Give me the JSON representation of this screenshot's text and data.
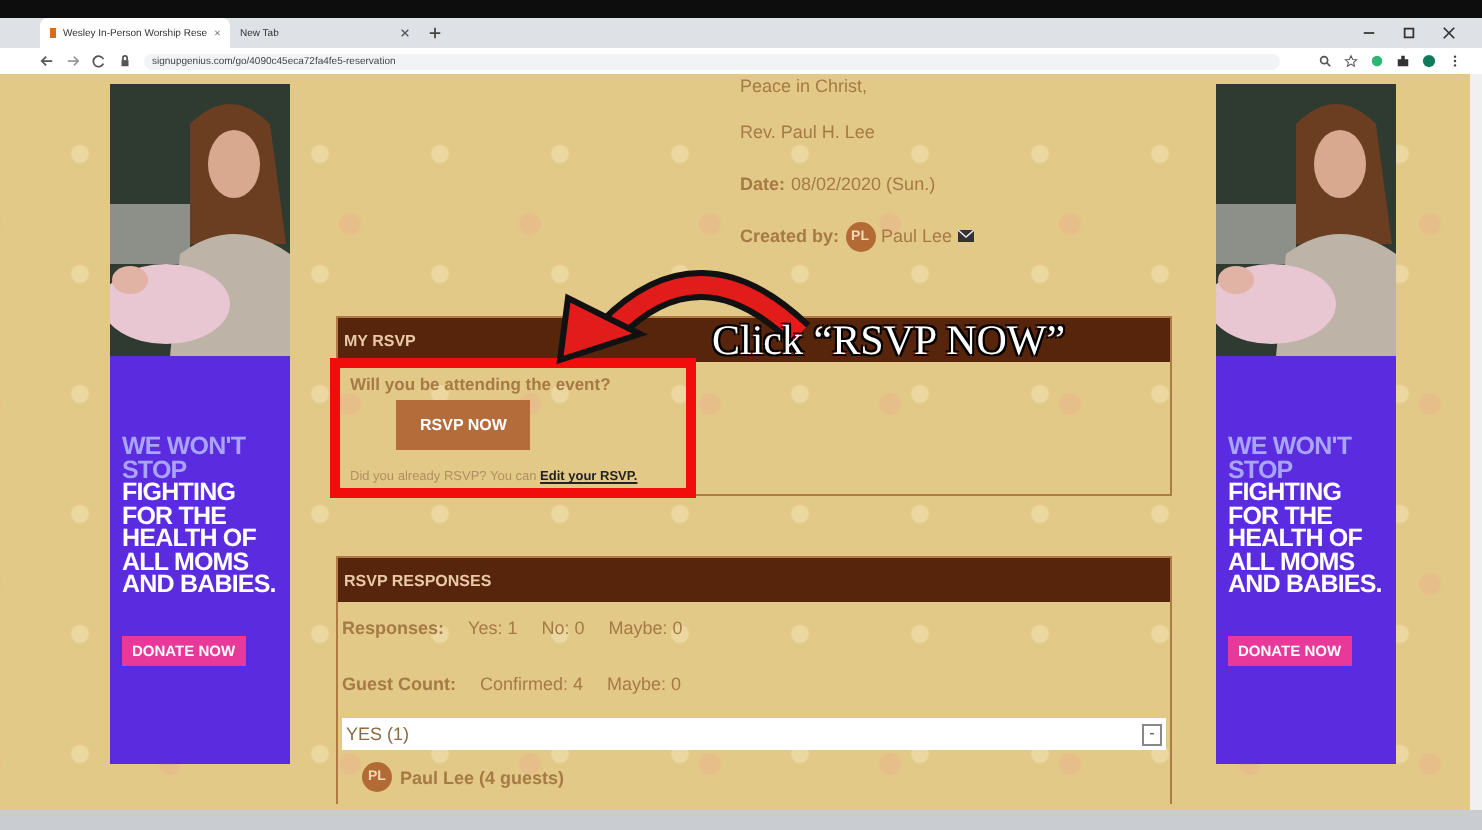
{
  "browser": {
    "tabs": [
      {
        "title": "Wesley In-Person Worship Rese",
        "selected": true
      },
      {
        "title": "New Tab",
        "selected": false
      }
    ],
    "url": "signupgenius.com/go/4090c45eca72fa4fe5-reservation"
  },
  "ads": [
    {
      "headline_accent": "WE WON'T STOP",
      "headline": "FIGHTING FOR THE HEALTH OF ALL MOMS AND BABIES.",
      "button": "DONATE NOW"
    },
    {
      "headline_accent": "WE WON'T STOP",
      "headline": "FIGHTING FOR THE HEALTH OF ALL MOMS AND BABIES.",
      "button": "DONATE NOW"
    }
  ],
  "event": {
    "closing": "Peace in Christ,",
    "signature": "Rev. Paul H. Lee",
    "date_label": "Date:",
    "date": "08/02/2020 (Sun.)",
    "creator_label": "Created by:",
    "creator_initials": "PL",
    "creator": "Paul Lee"
  },
  "my_rsvp": {
    "title": "MY RSVP",
    "question": "Will you be attending the event?",
    "button": "RSVP NOW",
    "note": "Did you already RSVP? You can",
    "link": "Edit your RSVP."
  },
  "overlay": {
    "caption": "Click “RSVP NOW”"
  },
  "responses": {
    "title": "RSVP RESPONSES",
    "rows": [
      {
        "label": "Responses:",
        "values": [
          "Yes: 1",
          "No: 0",
          "Maybe: 0"
        ]
      },
      {
        "label": "Guest Count:",
        "values": [
          "Confirmed: 4",
          "Maybe: 0"
        ]
      }
    ],
    "groups": [
      {
        "title": "YES (1)",
        "toggle": "-",
        "members": [
          {
            "initials": "PL",
            "name": "Paul Lee (4 guests)"
          }
        ]
      }
    ]
  }
}
